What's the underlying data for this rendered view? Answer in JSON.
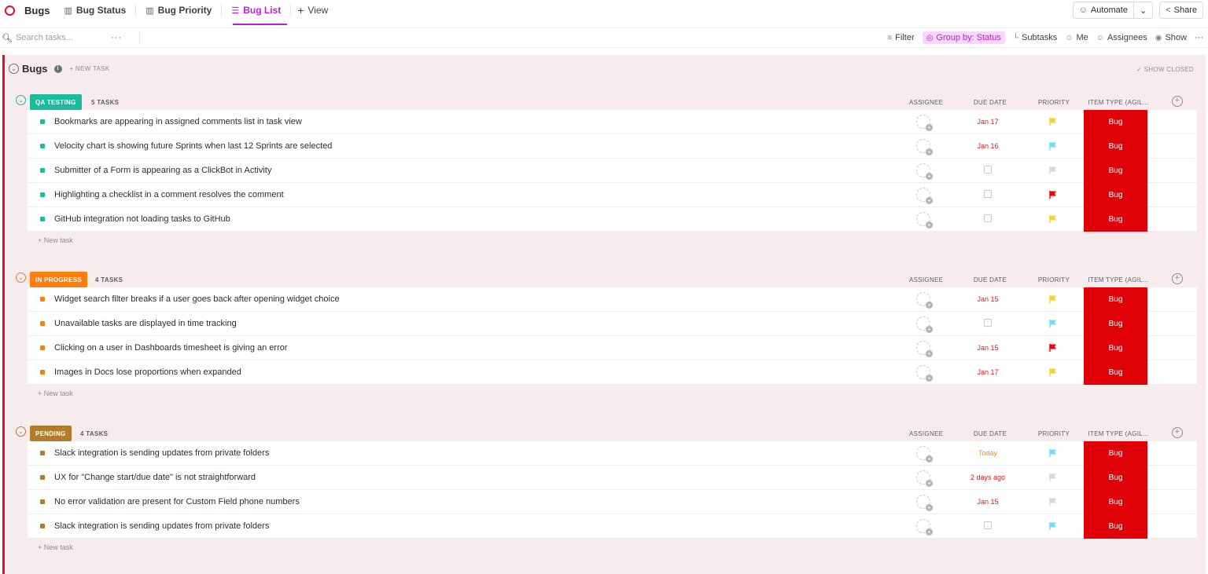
{
  "topbar": {
    "space_name": "Bugs",
    "tabs": [
      {
        "label": "Bug Status",
        "icon": "board-icon",
        "active": false
      },
      {
        "label": "Bug Priority",
        "icon": "board-icon",
        "active": false
      },
      {
        "label": "Bug List",
        "icon": "list-icon",
        "active": true
      }
    ],
    "add_view_label": "View",
    "automate_label": "Automate",
    "share_label": "Share"
  },
  "toolbar": {
    "search_placeholder": "Search tasks...",
    "filter_label": "Filter",
    "group_by_label": "Group by: Status",
    "subtasks_label": "Subtasks",
    "me_label": "Me",
    "assignees_label": "Assignees",
    "show_label": "Show"
  },
  "list": {
    "title": "Bugs",
    "new_task_label": "+ NEW TASK",
    "show_closed_label": "SHOW CLOSED",
    "columns": {
      "assignee": "ASSIGNEE",
      "due": "DUE DATE",
      "priority": "PRIORITY",
      "item_type": "ITEM TYPE (AGIL..."
    },
    "new_task_row_label": "+ New task",
    "groups": [
      {
        "status": "QA TESTING",
        "color": "#1bbc9c",
        "count": "5 TASKS",
        "tasks": [
          {
            "name": "Bookmarks are appearing in assigned comments list in task view",
            "due": "Jan 17",
            "priority": "yellow",
            "type": "Bug"
          },
          {
            "name": "Velocity chart is showing future Sprints when last 12 Sprints are selected",
            "due": "Jan 16",
            "priority": "blue",
            "type": "Bug"
          },
          {
            "name": "Submitter of a Form is appearing as a ClickBot in Activity",
            "due": "",
            "priority": "gray",
            "type": "Bug"
          },
          {
            "name": "Highlighting a checklist in a comment resolves the comment",
            "due": "",
            "priority": "red",
            "type": "Bug"
          },
          {
            "name": "GitHub integration not loading tasks to GitHub",
            "due": "",
            "priority": "yellow",
            "type": "Bug"
          }
        ]
      },
      {
        "status": "IN PROGRESS",
        "color": "#fd7e0d",
        "count": "4 TASKS",
        "tasks": [
          {
            "name": "Widget search filter breaks if a user goes back after opening widget choice",
            "due": "Jan 15",
            "priority": "yellow",
            "type": "Bug"
          },
          {
            "name": "Unavailable tasks are displayed in time tracking",
            "due": "",
            "priority": "blue",
            "type": "Bug"
          },
          {
            "name": "Clicking on a user in Dashboards timesheet is giving an error",
            "due": "Jan 15",
            "priority": "red",
            "type": "Bug"
          },
          {
            "name": "Images in Docs lose proportions when expanded",
            "due": "Jan 17",
            "priority": "yellow",
            "type": "Bug"
          }
        ]
      },
      {
        "status": "PENDING",
        "color": "#b47b2c",
        "count": "4 TASKS",
        "tasks": [
          {
            "name": "Slack integration is sending updates from private folders",
            "due": "Today",
            "priority": "blue",
            "type": "Bug"
          },
          {
            "name": "UX for \"Change start/due date\" is not straightforward",
            "due": "2 days ago",
            "priority": "gray",
            "type": "Bug"
          },
          {
            "name": "No error validation are present for Custom Field phone numbers",
            "due": "Jan 15",
            "priority": "gray",
            "type": "Bug"
          },
          {
            "name": "Slack integration is sending updates from private folders",
            "due": "",
            "priority": "blue",
            "type": "Bug"
          }
        ]
      }
    ]
  },
  "colors": {
    "accent": "#c21cdb",
    "bug_red": "#e00007",
    "overdue": "#e5141d",
    "today": "#f58b2f"
  }
}
